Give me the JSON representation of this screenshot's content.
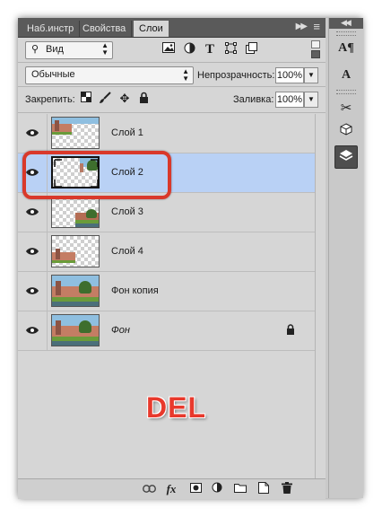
{
  "tabs": [
    {
      "label": "Наб.инстр",
      "active": false
    },
    {
      "label": "Свойства",
      "active": false
    },
    {
      "label": "Слои",
      "active": true
    }
  ],
  "filter": {
    "kind_label": "Вид"
  },
  "blend_mode": {
    "value": "Обычные"
  },
  "opacity": {
    "label": "Непрозрачность:",
    "value": "100%"
  },
  "lock": {
    "label": "Закрепить:"
  },
  "fill": {
    "label": "Заливка:",
    "value": "100%"
  },
  "layers": [
    {
      "name": "Слой 1",
      "visible": true,
      "selected": false,
      "locked": false,
      "italic": false
    },
    {
      "name": "Слой 2",
      "visible": true,
      "selected": true,
      "locked": false,
      "italic": false
    },
    {
      "name": "Слой 3",
      "visible": true,
      "selected": false,
      "locked": false,
      "italic": false
    },
    {
      "name": "Слой 4",
      "visible": true,
      "selected": false,
      "locked": false,
      "italic": false
    },
    {
      "name": "Фон копия",
      "visible": true,
      "selected": false,
      "locked": false,
      "italic": false
    },
    {
      "name": "Фон",
      "visible": true,
      "selected": false,
      "locked": true,
      "italic": true
    }
  ],
  "annotation": {
    "text": "DEL",
    "color": "#e8392c"
  },
  "colors": {
    "selection": "#b9d1f5",
    "highlight": "#d9392b",
    "panel": "#d6d6d6",
    "tabbar": "#5a5a5a"
  }
}
